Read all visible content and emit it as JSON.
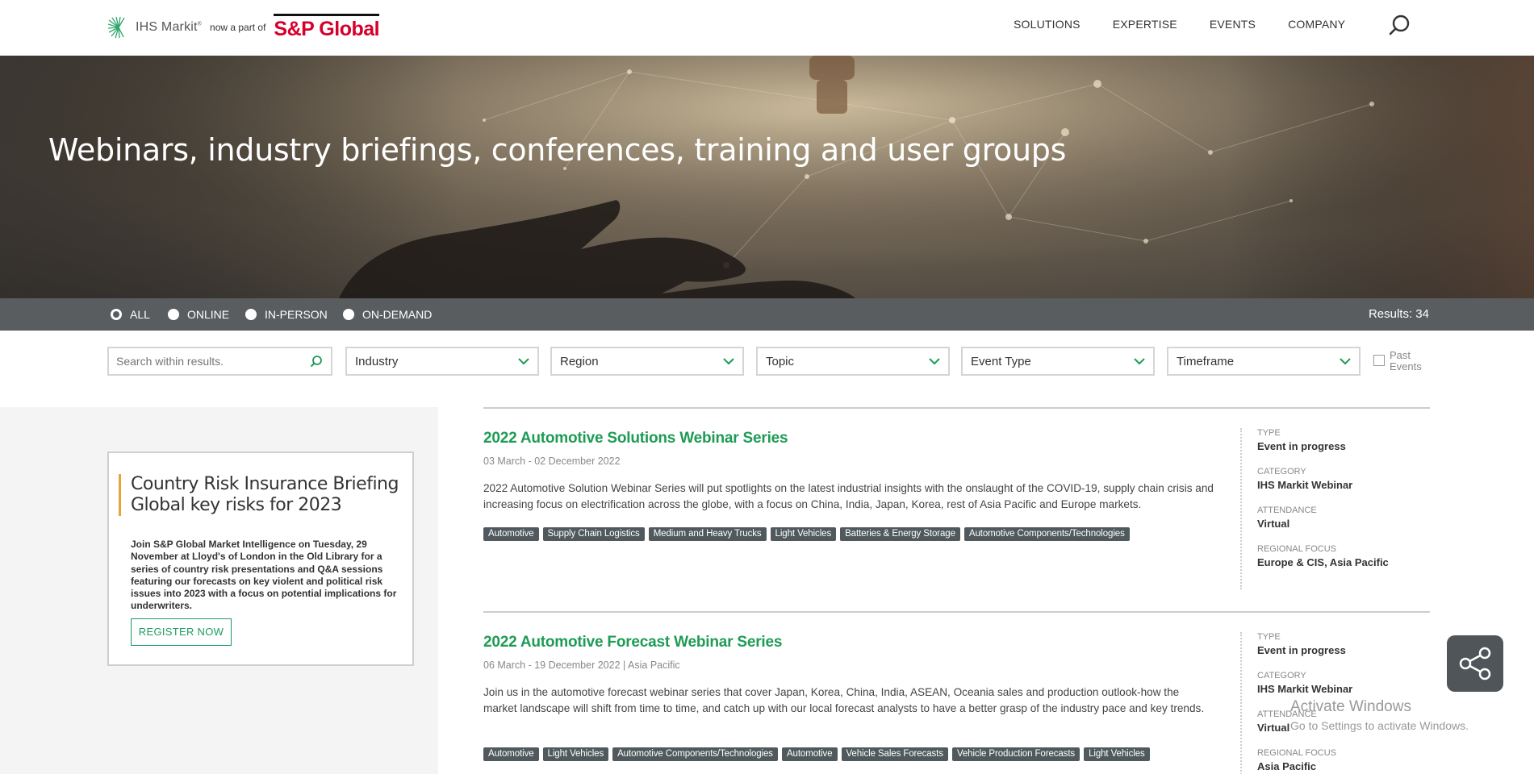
{
  "header": {
    "brand": "IHS Markit",
    "brand_mark": "®",
    "now_part": "now a part of",
    "parent_brand": "S&P Global",
    "nav": [
      "SOLUTIONS",
      "EXPERTISE",
      "EVENTS",
      "COMPANY"
    ]
  },
  "hero": {
    "title": "Webinars, industry briefings, conferences, training and user groups"
  },
  "type_filter": {
    "options": [
      "ALL",
      "ONLINE",
      "IN-PERSON",
      "ON-DEMAND"
    ],
    "selected": "ALL",
    "results": "Results: 34"
  },
  "filters": {
    "search_placeholder": "Search within results.",
    "selects": [
      "Industry",
      "Region",
      "Topic",
      "Event Type",
      "Timeframe"
    ],
    "past_events_line1": "Past",
    "past_events_line2": "Events"
  },
  "promo": {
    "title_line1": "Country Risk Insurance Briefing",
    "title_line2": "Global key risks for 2023",
    "description": "Join S&P Global Market Intelligence on Tuesday, 29 November at Lloyd's of London in the Old Library for a series of country risk presentations and Q&A sessions featuring our forecasts on key violent and political risk issues into 2023 with a focus on potential implications for underwriters.",
    "button": "REGISTER NOW"
  },
  "events": [
    {
      "title": "2022 Automotive Solutions Webinar Series",
      "date": "03 March - 02 December 2022",
      "description": "2022 Automotive Solution Webinar Series will put spotlights on the latest industrial insights with the onslaught of the COVID-19, supply chain crisis and increasing focus on electrification across the globe, with a focus on China, India, Japan, Korea, rest of Asia Pacific and Europe markets.",
      "tags": [
        "Automotive",
        "Supply Chain Logistics",
        "Medium and Heavy Trucks",
        "Light Vehicles",
        "Batteries & Energy Storage",
        "Automotive Components/Technologies"
      ],
      "type_label": "TYPE",
      "type": "Event in progress",
      "category_label": "CATEGORY",
      "category": "IHS Markit Webinar",
      "attendance_label": "ATTENDANCE",
      "attendance": "Virtual",
      "region_label": "REGIONAL FOCUS",
      "region": "Europe & CIS, Asia Pacific"
    },
    {
      "title": "2022 Automotive Forecast Webinar Series",
      "date": "06 March - 19 December 2022 | Asia Pacific",
      "description": "Join us in the automotive forecast webinar series that cover Japan, Korea, China, India, ASEAN, Oceania sales and production outlook-how the market landscape will shift from time to time, and catch up with our local forecast analysts to have a better grasp of the industry pace and key trends.",
      "tags": [
        "Automotive",
        "Light Vehicles",
        "Automotive Components/Technologies",
        "Automotive",
        "Vehicle Sales Forecasts",
        "Vehicle Production Forecasts",
        "Light Vehicles"
      ],
      "type_label": "TYPE",
      "type": "Event in progress",
      "category_label": "CATEGORY",
      "category": "IHS Markit Webinar",
      "attendance_label": "ATTENDANCE",
      "attendance": "Virtual",
      "region_label": "REGIONAL FOCUS",
      "region": "Asia Pacific"
    }
  ],
  "watermark": {
    "line1": "Activate Windows",
    "line2": "Go to Settings to activate Windows."
  }
}
